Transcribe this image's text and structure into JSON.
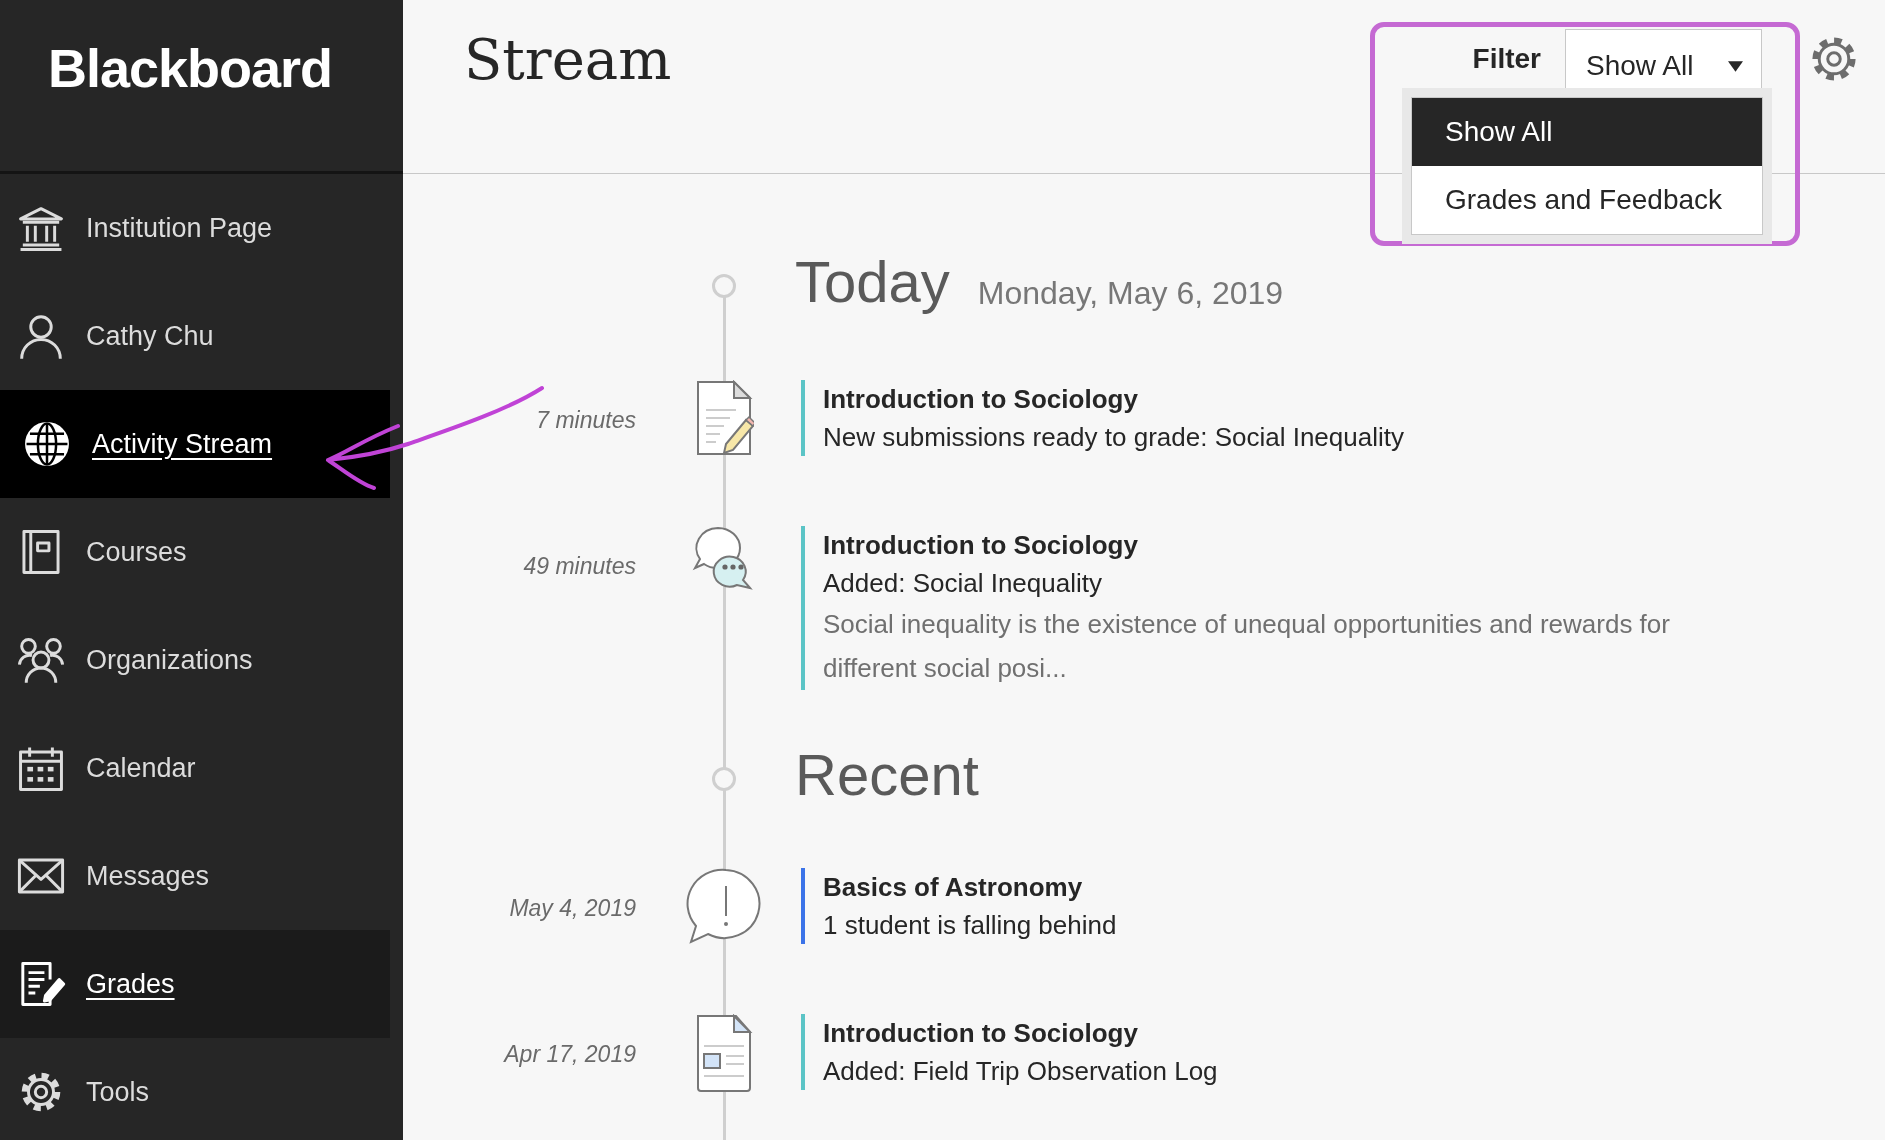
{
  "sidebar": {
    "logo": "Blackboard",
    "items": [
      {
        "label": "Institution Page",
        "selected": false,
        "hovered": false
      },
      {
        "label": "Cathy Chu",
        "selected": false,
        "hovered": false
      },
      {
        "label": "Activity Stream",
        "selected": true,
        "hovered": false
      },
      {
        "label": "Courses",
        "selected": false,
        "hovered": false
      },
      {
        "label": "Organizations",
        "selected": false,
        "hovered": false
      },
      {
        "label": "Calendar",
        "selected": false,
        "hovered": false
      },
      {
        "label": "Messages",
        "selected": false,
        "hovered": false
      },
      {
        "label": "Grades",
        "selected": false,
        "hovered": true
      },
      {
        "label": "Tools",
        "selected": false,
        "hovered": false
      }
    ]
  },
  "header": {
    "title": "Stream",
    "filter": {
      "label": "Filter",
      "value": "Show All",
      "expanded": true,
      "options": [
        {
          "label": "Show All",
          "selected": true
        },
        {
          "label": "Grades and Feedback",
          "selected": false
        }
      ]
    }
  },
  "sections": [
    {
      "heading": "Today",
      "date": "Monday, May 6, 2019",
      "entries": [
        {
          "time": "7 minutes",
          "kind": "grading",
          "course": "Introduction to Sociology",
          "text": "New submissions ready to grade: Social Inequality",
          "color": "#5bc4c6"
        },
        {
          "time": "49 minutes",
          "kind": "discussion",
          "course": "Introduction to Sociology",
          "text": "Added: Social Inequality",
          "preview": "Social inequality is the existence of unequal opportunities and rewards for different social posi...",
          "color": "#5bc4c6"
        }
      ]
    },
    {
      "heading": "Recent",
      "entries": [
        {
          "time": "May 4, 2019",
          "kind": "alert",
          "course": "Basics of Astronomy",
          "text": "1 student is falling behind",
          "color": "#3b73e8"
        },
        {
          "time": "Apr 17, 2019",
          "kind": "document",
          "course": "Introduction to Sociology",
          "text": "Added: Field Trip Observation Log",
          "color": "#5bc4c6"
        }
      ]
    }
  ]
}
